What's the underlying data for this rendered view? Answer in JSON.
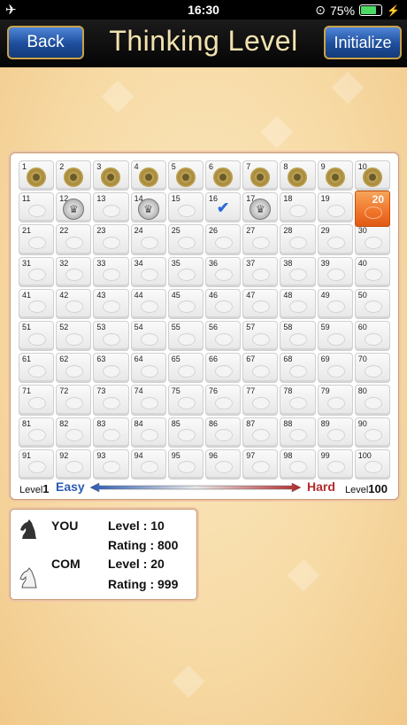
{
  "status_bar": {
    "time": "16:30",
    "battery": "75%"
  },
  "header": {
    "back_label": "Back",
    "title": "Thinking Level",
    "init_label": "Initialize"
  },
  "board": {
    "selected_level": 20,
    "coin_levels": [
      1,
      2,
      3,
      4,
      5,
      6,
      7,
      8,
      9,
      10
    ],
    "crown_levels": [
      12,
      14,
      17
    ],
    "check_levels": [
      16
    ]
  },
  "scale": {
    "left_prefix": "Level",
    "left_num": "1",
    "easy": "Easy",
    "hard": "Hard",
    "right_prefix": "Level",
    "right_num": "100"
  },
  "players": {
    "you": {
      "name": "YOU",
      "level_label": "Level : 10",
      "rating_label": "Rating : 800"
    },
    "com": {
      "name": "COM",
      "level_label": "Level : 20",
      "rating_label": "Rating : 999"
    }
  }
}
